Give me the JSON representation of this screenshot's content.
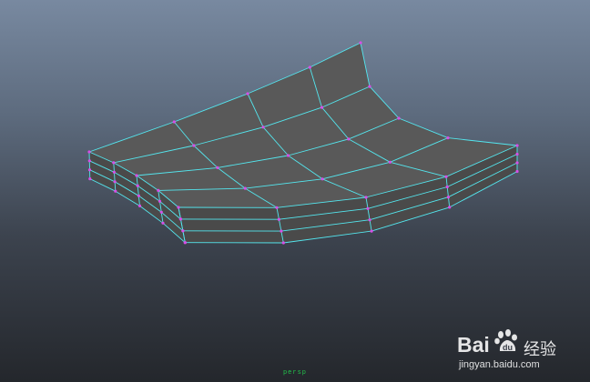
{
  "viewport": {
    "background_top": "#7889a0",
    "background_bottom": "#24272c",
    "object": "polygon-mesh-slab",
    "face_color": "#595959",
    "edge_color": "#54e6ee",
    "vertex_color": "#d64fe6",
    "grid_divisions": {
      "u": 4,
      "v": 4
    },
    "thickness_layers": 3
  },
  "status": {
    "readout": "persp"
  },
  "watermark": {
    "brand_prefix": "Bai",
    "brand_suffix": "经验",
    "url": "jingyan.baidu.com",
    "icon": "baidu-paw-icon"
  }
}
